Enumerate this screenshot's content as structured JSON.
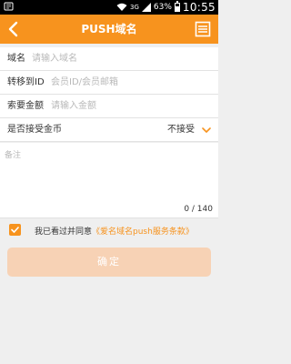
{
  "status_bar": {
    "network": "3G",
    "battery_percent": "63%",
    "battery_level": 0.63,
    "time": "10:55"
  },
  "header": {
    "title": "PUSH域名",
    "back_icon": "back-arrow-icon",
    "menu_icon": "menu-list-icon",
    "color": "#f7931e"
  },
  "form": {
    "domain": {
      "label": "域名",
      "placeholder": "请输入域名"
    },
    "transfer_to": {
      "label": "转移到ID",
      "placeholder": "会员ID/会员邮箱"
    },
    "amount": {
      "label": "索要金额",
      "placeholder": "请输入金额"
    },
    "accept_coins": {
      "label": "是否接受金币",
      "value": "不接受"
    },
    "remark": {
      "placeholder": "备注",
      "counter": "0 / 140"
    }
  },
  "agreement": {
    "checked": true,
    "text": "我已看过并同意",
    "link": "《爱名域名push服务条款》"
  },
  "confirm_button": {
    "label": "确定"
  }
}
